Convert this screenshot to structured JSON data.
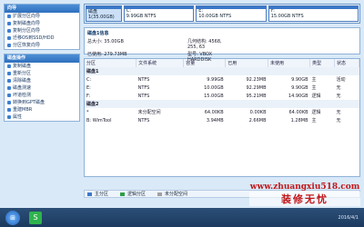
{
  "sidebar": {
    "wizard": {
      "title": "向导",
      "items": [
        "扩展分区向导",
        "复制磁盘向导",
        "复制分区向导",
        "迁移OS到SSD/HDD",
        "分区恢复向导"
      ]
    },
    "disk_ops": {
      "title": "磁盘操作",
      "items": [
        "复制磁盘",
        "重新分区",
        "清除磁盘",
        "磁盘测速",
        "坏道检测",
        "转换到GPT磁盘",
        "重建MBR",
        "属性"
      ]
    }
  },
  "disk_map": {
    "partitions": [
      {
        "label": "磁盘1(35.00GB)",
        "selected": true
      },
      {
        "label": "C:"
      },
      {
        "label": "E:"
      },
      {
        "label": "F:"
      }
    ],
    "sizes": [
      "",
      "9.99GB NTFS",
      "10.00GB NTFS",
      "15.00GB NTFS"
    ]
  },
  "disk_info": {
    "title": "磁盘1信息",
    "rows": [
      {
        "k": "总大小: 35.00GB",
        "k2": "几何结构: 4568, 255, 63"
      },
      {
        "k": "已使用: 279.73MB",
        "k2": "型号: VBOX HARDDISK"
      }
    ]
  },
  "table": {
    "headers": [
      "分区",
      "文件系统",
      "容量",
      "已用",
      "未使用",
      "类型",
      "状态"
    ],
    "groups": [
      {
        "name": "磁盘1",
        "rows": [
          [
            "C:",
            "NTFS",
            "9.99GB",
            "92.23MB",
            "9.90GB",
            "主",
            "活动"
          ],
          [
            "E:",
            "NTFS",
            "10.00GB",
            "92.29MB",
            "9.90GB",
            "主",
            "无"
          ],
          [
            "F:",
            "NTFS",
            "15.00GB",
            "95.21MB",
            "14.90GB",
            "逻辑",
            "无"
          ]
        ]
      },
      {
        "name": "磁盘2",
        "rows": [
          [
            "*",
            "未分配空间",
            "64.00KB",
            "0.00KB",
            "64.00KB",
            "逻辑",
            "无"
          ],
          [
            "B: WimTool",
            "NTFS",
            "3.94MB",
            "2.66MB",
            "1.28MB",
            "主",
            "无"
          ]
        ]
      }
    ]
  },
  "legend": [
    {
      "label": "主分区",
      "color": "#3b78c8"
    },
    {
      "label": "逻辑分区",
      "color": "#2f9e44"
    },
    {
      "label": "未分配空间",
      "color": "#a0a0a0"
    }
  ],
  "taskbar": {
    "app_glyph": "S",
    "clock": "2016/4/1"
  },
  "watermark": {
    "url": "www.zhuangxiu518.com",
    "text": "装修无忧"
  }
}
